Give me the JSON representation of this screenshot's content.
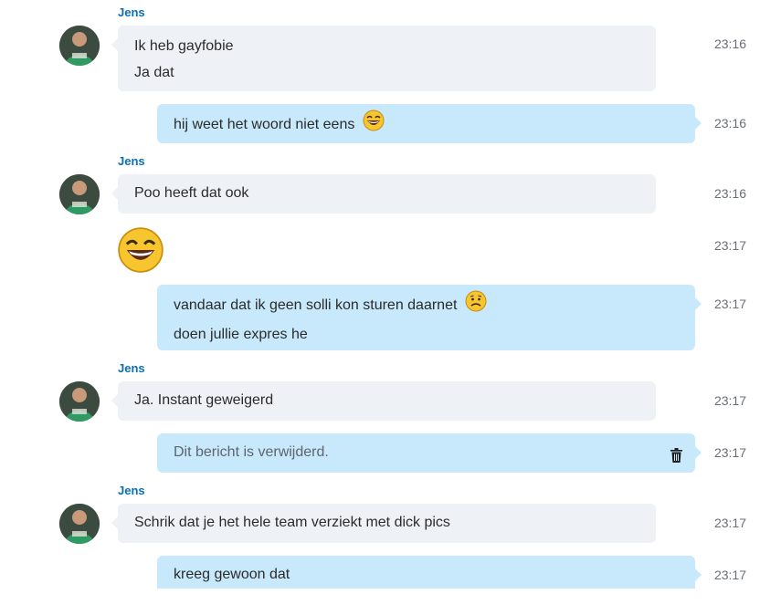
{
  "sender_name": "Jens",
  "messages": [
    {
      "lines": [
        "Ik heb gayfobie",
        "Ja dat"
      ],
      "time": "23:16"
    },
    {
      "text": "hij weet het woord niet eens",
      "emoji": "laughing-emoji",
      "time": "23:16"
    },
    {
      "text": "Poo heeft dat ook",
      "time": "23:16"
    },
    {
      "emoji": "laughing-emoji",
      "time": "23:17"
    },
    {
      "lines": [
        "vandaar dat ik geen solli kon sturen daarnet",
        "doen jullie expres he"
      ],
      "emoji": "sad-emoji",
      "time": "23:17"
    },
    {
      "text": "Ja. Instant geweigerd",
      "time": "23:17"
    },
    {
      "text": "Dit bericht is verwijderd.",
      "icon": "trash-icon",
      "time": "23:17"
    },
    {
      "text": "Schrik dat je het hele team verziekt met dick pics",
      "time": "23:17"
    },
    {
      "text": "kreeg gewoon dat",
      "time": "23:17"
    }
  ],
  "colors": {
    "incoming_bubble": "#eef1f6",
    "outgoing_bubble": "#c8e9fb",
    "sender_name": "#0a6fb3",
    "timestamp": "#6a6f76"
  }
}
